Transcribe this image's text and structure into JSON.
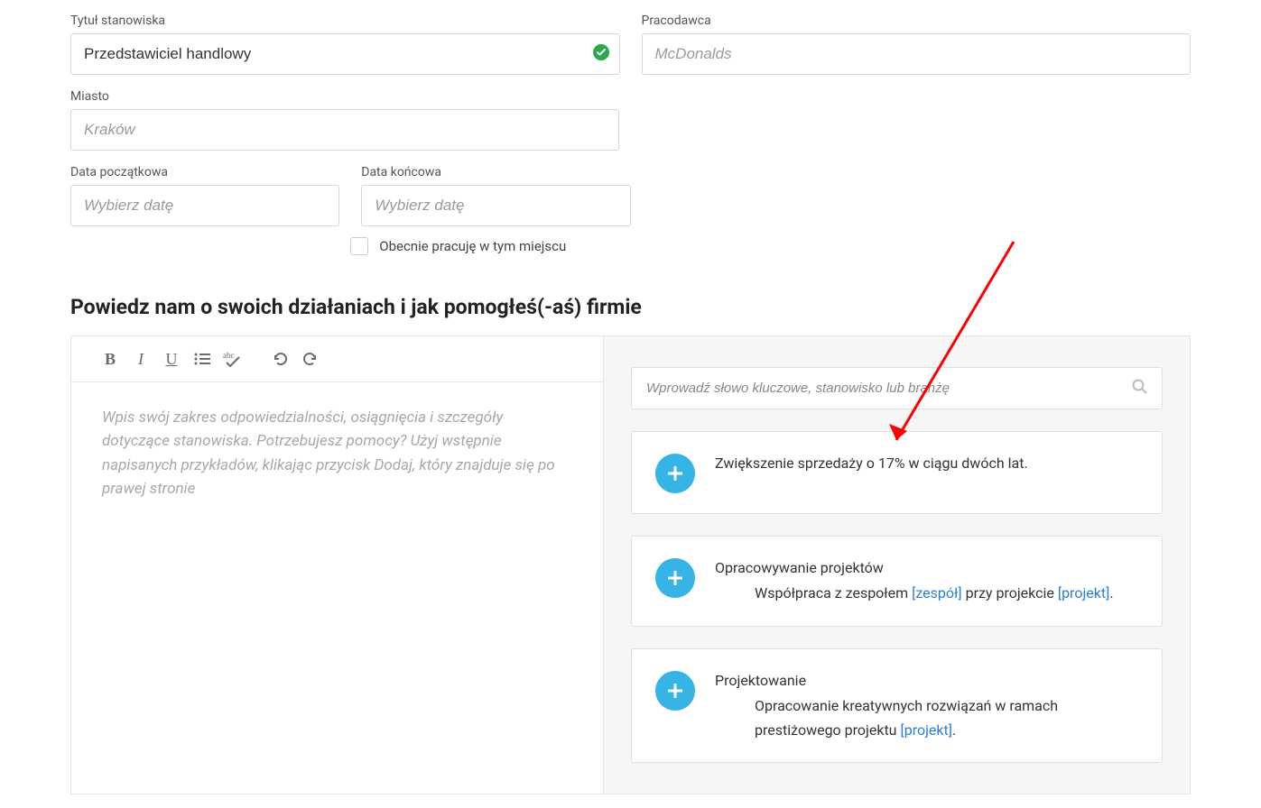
{
  "fields": {
    "jobTitle": {
      "label": "Tytuł stanowiska",
      "value": "Przedstawiciel handlowy"
    },
    "employer": {
      "label": "Pracodawca",
      "placeholder": "McDonalds"
    },
    "city": {
      "label": "Miasto",
      "placeholder": "Kraków"
    },
    "startDate": {
      "label": "Data początkowa",
      "placeholder": "Wybierz datę"
    },
    "endDate": {
      "label": "Data końcowa",
      "placeholder": "Wybierz datę"
    },
    "current": {
      "label": "Obecnie pracuję w tym miejscu"
    }
  },
  "sectionTitle": "Powiedz nam o swoich działaniach i jak pomogłeś(-aś) firmie",
  "editor": {
    "placeholder": "Wpis swój zakres odpowiedzialności, osiągnięcia i szczegóły dotyczące stanowiska. Potrzebujesz pomocy? Użyj wstępnie napisanych przykładów, klikając przycisk Dodaj, który znajduje się po prawej stronie"
  },
  "search": {
    "placeholder": "Wprowadź słowo kluczowe, stanowisko lub branżę"
  },
  "suggestions": [
    {
      "text": "Zwiększenie sprzedaży o 17% w ciągu dwóch lat."
    },
    {
      "title": "Opracowywanie projektów",
      "pre": "Współpraca z zespołem ",
      "tok1": "[zespół]",
      "mid": " przy projekcie ",
      "tok2": "[projekt]",
      "post": "."
    },
    {
      "title": "Projektowanie",
      "pre": "Opracowanie kreatywnych rozwiązań w ramach prestiżowego projektu ",
      "tok1": "[projekt]",
      "post": "."
    }
  ]
}
